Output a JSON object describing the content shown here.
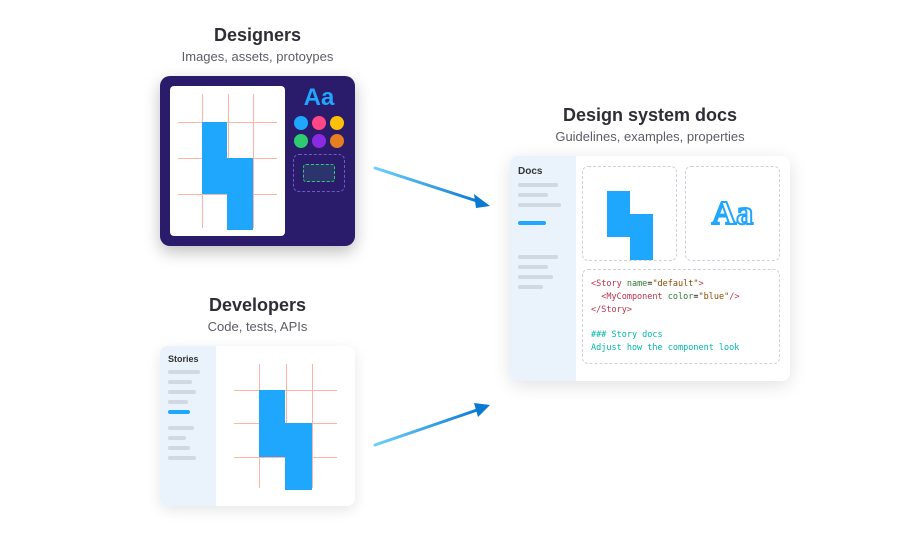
{
  "designers": {
    "title": "Designers",
    "subtitle": "Images, assets, protoypes",
    "aa_label": "Aa",
    "swatches": [
      "#1ea7fd",
      "#ff4785",
      "#ffc107",
      "#2ecc71",
      "#8a2be2",
      "#e67e22"
    ]
  },
  "developers": {
    "title": "Developers",
    "subtitle": "Code, tests, APIs",
    "sidebar_label": "Stories"
  },
  "docs": {
    "title": "Design system docs",
    "subtitle": "Guidelines, examples, properties",
    "sidebar_label": "Docs",
    "aa_label": "Aa",
    "code": {
      "l1_open": "<Story ",
      "l1_attr": "name",
      "l1_eq": "=",
      "l1_val": "\"default\"",
      "l1_close": ">",
      "l2_open": "  <MyComponent ",
      "l2_attr": "color",
      "l2_eq": "=",
      "l2_val": "\"blue\"",
      "l2_close": "/>",
      "l3": "</Story>",
      "l4": "### Story docs",
      "l5": "Adjust how the component look"
    }
  },
  "colors": {
    "accent": "#1ea7fd",
    "dark_purple": "#2b1b6b",
    "pale_blue": "#eaf3fb"
  }
}
